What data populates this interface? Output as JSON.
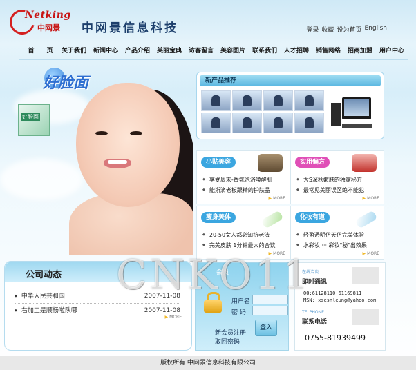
{
  "header": {
    "logo_en": "Netking",
    "logo_cn": "中网景",
    "company_name": "中网景信息科技",
    "top_links": [
      "登录",
      "收藏",
      "设为首页",
      "English"
    ]
  },
  "nav": {
    "items": [
      "首",
      "页",
      "关于我们",
      "新闻中心",
      "产品介绍",
      "美丽宝典",
      "访客留言",
      "美容图片",
      "联系我们",
      "人才招聘",
      "销售网络",
      "招商加盟",
      "用户中心"
    ]
  },
  "hero": {
    "slogan": "好脸面",
    "product_label": "好脸面"
  },
  "new_products": {
    "title": "新产品推荐"
  },
  "categories": [
    {
      "tag": "小贴美容",
      "color": "#3ba6e0",
      "items": [
        "享受周末-香氛泡浴唤醒肌",
        "能斯滴老板跟精的护肤品"
      ],
      "more": "MORE"
    },
    {
      "tag": "实用偏方",
      "color": "#e04fb7",
      "items": [
        "大S深秋嫩肤的独家秘方",
        "最常见美丽误区绝不能犯"
      ],
      "more": "MORE"
    },
    {
      "tag": "瘦身美体",
      "color": "#3ba6e0",
      "items": [
        "20-50女人都必知抗老法",
        "完美皮肤 1分钟最大的合饮"
      ],
      "more": "MORE"
    },
    {
      "tag": "化妆有道",
      "color": "#3ba6e0",
      "items": [
        "轻盈透明仿天仿完美体验",
        "水彩妆 ··· 彩妆\"秘\"出效果"
      ],
      "more": "MORE"
    }
  ],
  "news": {
    "title": "公司动态",
    "items": [
      {
        "title": "中华人民共和国",
        "date": "2007-11-08"
      },
      {
        "title": "右加工是顺畅啦队哪",
        "date": "2007-11-08"
      }
    ],
    "more": "MORE"
  },
  "login": {
    "header": "会员",
    "username_label": "用户名",
    "password_label": "密  码",
    "username_value": "",
    "password_value": "",
    "register_link": "新会员注册",
    "recover_link": "取回密码",
    "submit_label": "登入"
  },
  "contact": {
    "online_tag": "在线洽谈",
    "online_title": "即时通讯",
    "qq": "QQ:61128110 61169811",
    "msn": "MSN: xsesnleung@yahoo.com",
    "phone_tag": "TELPHONE",
    "phone_title": "联系电话",
    "phone": "0755-81939499"
  },
  "footer": {
    "copyright": "版权所有  中网景信息科技有限公司"
  },
  "watermark": "CNKO11"
}
